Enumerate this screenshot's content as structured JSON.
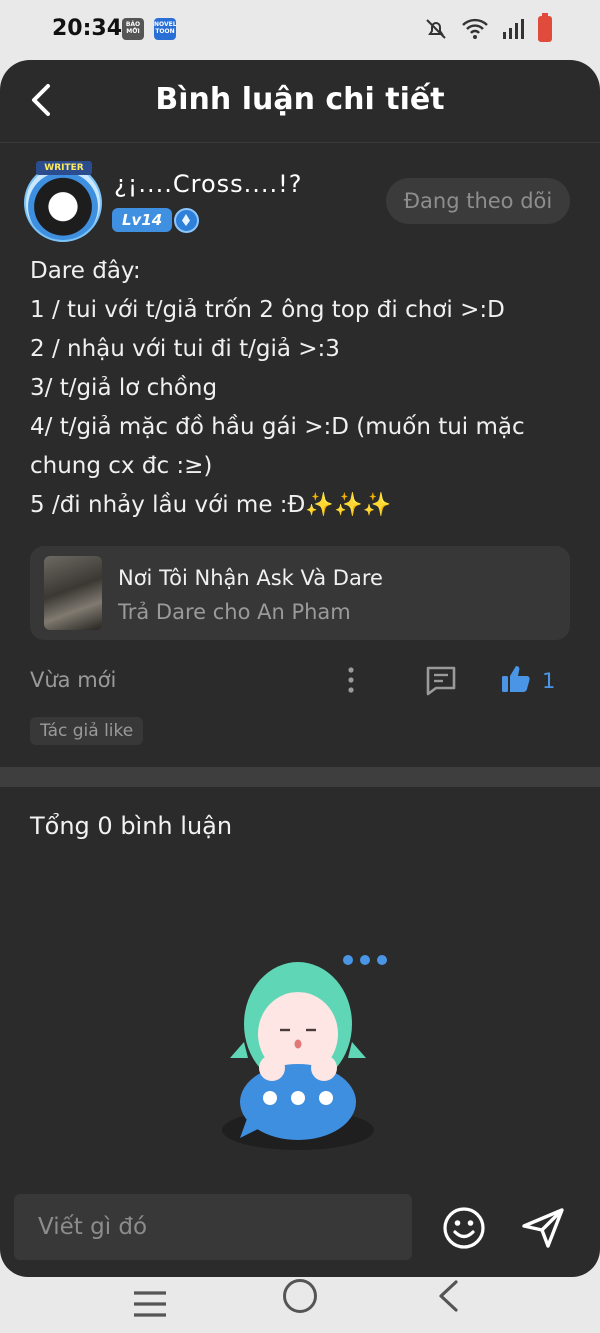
{
  "status_bar": {
    "time": "20:34",
    "notification_1": "BÁO MỚI",
    "notification_2": "NOVEL TOON"
  },
  "header": {
    "title": "Bình luận chi tiết"
  },
  "post": {
    "username": "¿¡....Cross....!?",
    "avatar_badge": "WRITER",
    "level": "Lv14",
    "follow_label": "Đang theo dõi",
    "content": "Dare đây:\n1 / tui với t/giả trốn 2 ông top đi chơi >:D\n2 / nhậu với tui đi t/giả >:3\n3/ t/giả lơ chồng\n4/ t/giả mặc đồ hầu gái >:D (muốn tui mặc chung cx đc :≥)\n5 /đi nhảy lầu với me :Đ✨✨✨",
    "story": {
      "title": "Nơi Tôi Nhận Ask Và Dare",
      "subtitle": "Trả Dare cho An Pham"
    },
    "time": "Vừa mới",
    "like_count": "1",
    "author_like": "Tác giả like"
  },
  "comments": {
    "total_label": "Tổng 0 bình luận"
  },
  "composer": {
    "placeholder": "Viết gì đó"
  },
  "colors": {
    "app_bg": "#2b2b2b",
    "accent": "#4a95e6",
    "muted_text": "#9a9a9a"
  }
}
